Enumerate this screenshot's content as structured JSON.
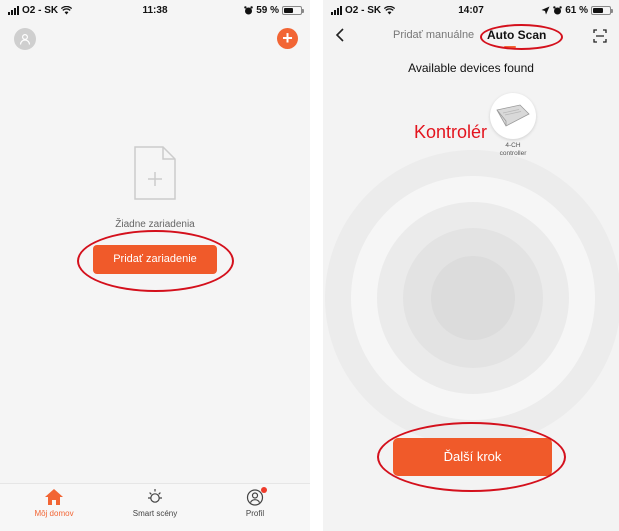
{
  "left_screen": {
    "status": {
      "carrier": "O2 - SK",
      "time": "11:38",
      "battery": "59 %",
      "battery_level": 0.59
    },
    "empty_text": "Žiadne zariadenia",
    "add_button_label": "Pridať zariadenie",
    "tabs": [
      {
        "label": "Môj domov",
        "icon": "home-icon",
        "active": true
      },
      {
        "label": "Smart scény",
        "icon": "sun-icon",
        "active": false
      },
      {
        "label": "Profil",
        "icon": "profile-icon",
        "active": false
      }
    ]
  },
  "right_screen": {
    "status": {
      "carrier": "O2 - SK",
      "time": "14:07",
      "battery": "61 %",
      "battery_level": 0.61
    },
    "nav": {
      "tab_manual": "Pridať manuálne",
      "tab_auto": "Auto Scan"
    },
    "found_title": "Available devices found",
    "device": {
      "name_line1": "4-CH",
      "name_line2": "controller"
    },
    "annotation": "Kontrolér",
    "next_button_label": "Ďalší krok"
  },
  "colors": {
    "accent": "#f26534",
    "annotation": "#d4101c"
  }
}
